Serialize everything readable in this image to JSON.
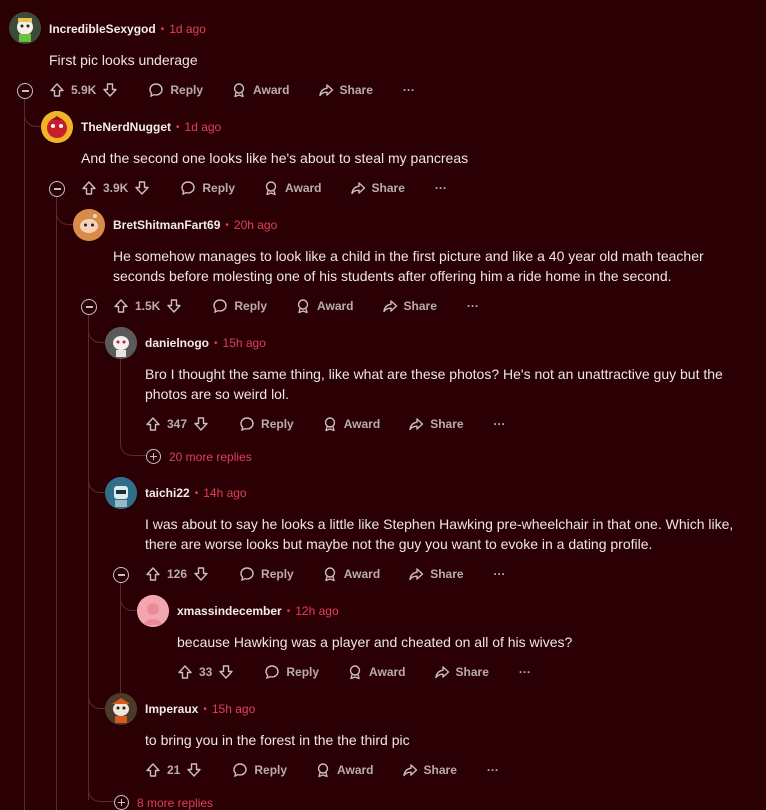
{
  "comments": [
    {
      "username": "IncredibleSexygod",
      "time": "1d ago",
      "body": "First pic looks underage",
      "score": "5.9K",
      "avatar_color": "#3b4a3a"
    },
    {
      "username": "TheNerdNugget",
      "time": "1d ago",
      "body": "And the second one looks like he's about to steal my pancreas",
      "score": "3.9K",
      "avatar_color": "#f0b429"
    },
    {
      "username": "BretShitmanFart69",
      "time": "20h ago",
      "body": "He somehow manages to look like a child in the first picture and like a 40 year old math teacher seconds before molesting one of his students after offering him a ride home in the second.",
      "score": "1.5K",
      "avatar_color": "#d98b4a"
    },
    {
      "username": "danielnogo",
      "time": "15h ago",
      "body": "Bro I thought the same thing, like what are these photos? He's not an unattractive guy but the photos are so weird lol.",
      "score": "347",
      "avatar_color": "#5a5a5a"
    },
    {
      "username": "taichi22",
      "time": "14h ago",
      "body": "I was about to say he looks a little like Stephen Hawking pre-wheelchair in that one. Which like, there are worse looks but maybe not the guy you want to evoke in a dating profile.",
      "score": "126",
      "avatar_color": "#2f6f8a"
    },
    {
      "username": "xmassindecember",
      "time": "12h ago",
      "body": "because Hawking was a player and cheated on all of his wives?",
      "score": "33",
      "avatar_color": "#f4a6b0"
    },
    {
      "username": "Imperaux",
      "time": "15h ago",
      "body": "to bring you in the forest in the the third pic",
      "score": "21",
      "avatar_color": "#4a3a2a"
    }
  ],
  "actions": {
    "reply": "Reply",
    "award": "Award",
    "share": "Share",
    "more": "···"
  },
  "more_replies": {
    "danielnogo": "20 more replies",
    "bottom": "8 more replies"
  },
  "colors": {
    "background": "#2a0004",
    "accent": "#e0405a",
    "muted": "#b9acae"
  }
}
